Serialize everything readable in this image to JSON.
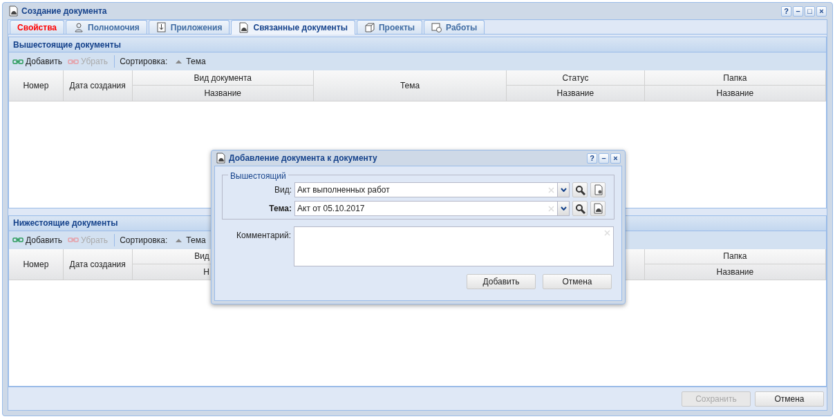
{
  "window": {
    "title": "Создание документа",
    "tool_buttons": [
      "?",
      "–",
      "□",
      "×"
    ]
  },
  "tabs": [
    {
      "label": "Свойства",
      "selected": false,
      "invalid": true
    },
    {
      "label": "Полномочия",
      "selected": false,
      "invalid": false
    },
    {
      "label": "Приложения",
      "selected": false,
      "invalid": false
    },
    {
      "label": "Связанные документы",
      "selected": true,
      "invalid": false
    },
    {
      "label": "Проекты",
      "selected": false,
      "invalid": false
    },
    {
      "label": "Работы",
      "selected": false,
      "invalid": false
    }
  ],
  "panels": [
    {
      "title": "Вышестоящие документы",
      "toolbar": [
        {
          "label": "Добавить",
          "disabled": false
        },
        {
          "label": "Убрать",
          "disabled": true
        }
      ],
      "sort_label": "Сортировка:",
      "sort_field": "Тема",
      "columns": [
        {
          "label": "Номер"
        },
        {
          "label": "Дата создания"
        },
        {
          "label": "Вид документа",
          "sub": "Название"
        },
        {
          "label": "Тема"
        },
        {
          "label": "Статус",
          "sub": "Название"
        },
        {
          "label": "Папка",
          "sub": "Название"
        }
      ]
    },
    {
      "title": "Нижестоящие документы",
      "toolbar": [
        {
          "label": "Добавить",
          "disabled": false
        },
        {
          "label": "Убрать",
          "disabled": true
        }
      ],
      "sort_label": "Сортировка:",
      "sort_field": "Тема",
      "columns": [
        {
          "label": "Номер"
        },
        {
          "label": "Дата создания"
        },
        {
          "label": "Вид",
          "sub": "Н",
          "covered": true
        },
        {},
        {},
        {
          "label": "Папка",
          "sub": "Название"
        }
      ]
    }
  ],
  "footer_buttons": [
    {
      "label": "Сохранить",
      "disabled": true
    },
    {
      "label": "Отмена",
      "disabled": false
    }
  ],
  "dialog": {
    "title": "Добавление документа к документу",
    "tool_buttons": [
      "?",
      "–",
      "×"
    ],
    "group_title": "Вышестоящий",
    "fields": [
      {
        "label": "Вид:",
        "value": "Акт выполненных работ",
        "required": false
      },
      {
        "label": "Тема:",
        "value": "Акт от 05.10.2017",
        "required": true
      }
    ],
    "comment_label": "Комментарий:",
    "buttons": [
      "Добавить",
      "Отмена"
    ]
  }
}
